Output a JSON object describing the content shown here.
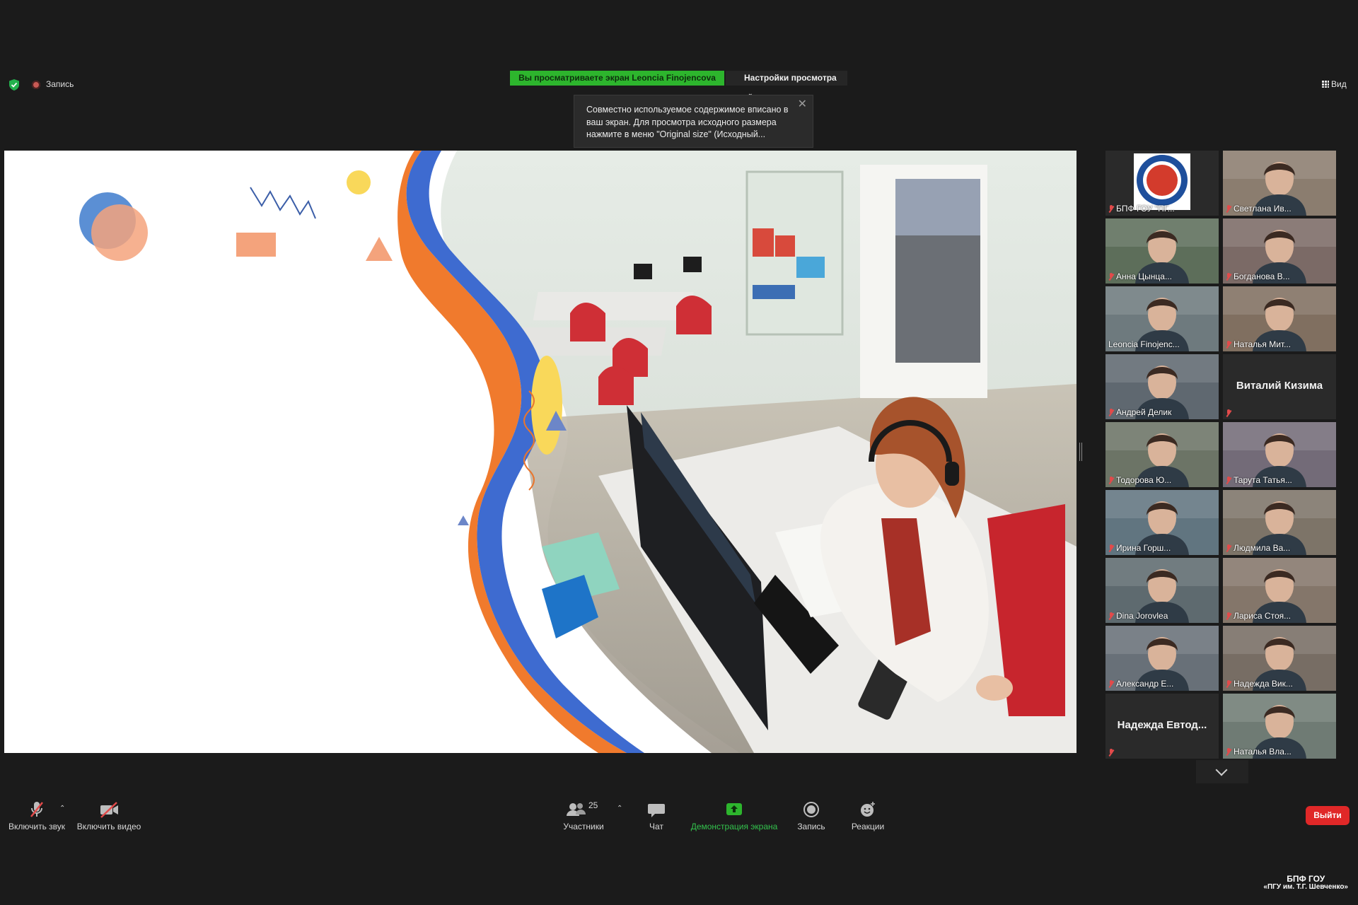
{
  "top_bar": {
    "recording_label": "Запись",
    "share_banner": "Вы просматриваете экран Leoncia Finojencova",
    "view_options": "Настройки просмотра",
    "view_button": "Вид"
  },
  "tooltip": {
    "text": "Совместно используемое содержимое вписано в ваш экран. Для просмотра исходного размера нажмите в меню \"Original size\" (Исходный..."
  },
  "gallery": [
    {
      "name": "БПФ ГОУ \"ПГ...",
      "muted": true,
      "kind": "logo"
    },
    {
      "name": "Светлана Ив...",
      "muted": true,
      "kind": "video"
    },
    {
      "name": "Анна Цынца...",
      "muted": true,
      "kind": "video"
    },
    {
      "name": "Богданова В...",
      "muted": true,
      "kind": "video"
    },
    {
      "name": "Leoncia Finojenc...",
      "muted": false,
      "kind": "video",
      "active": true
    },
    {
      "name": "Наталья Мит...",
      "muted": true,
      "kind": "video"
    },
    {
      "name": "Андрей Делик",
      "muted": true,
      "kind": "video"
    },
    {
      "name": "Виталий Кизима",
      "muted": true,
      "kind": "name"
    },
    {
      "name": "Тодорова Ю...",
      "muted": true,
      "kind": "video"
    },
    {
      "name": "Тарута Татья...",
      "muted": true,
      "kind": "video"
    },
    {
      "name": "Ирина Горш...",
      "muted": true,
      "kind": "video"
    },
    {
      "name": "Людмила Ва...",
      "muted": true,
      "kind": "video"
    },
    {
      "name": "Dina Jorovlea",
      "muted": true,
      "kind": "video"
    },
    {
      "name": "Лариса Стоя...",
      "muted": true,
      "kind": "video"
    },
    {
      "name": "Александр Е...",
      "muted": true,
      "kind": "video"
    },
    {
      "name": "Надежда Вик...",
      "muted": true,
      "kind": "video"
    },
    {
      "name": "Надежда  Евтод...",
      "muted": true,
      "kind": "name"
    },
    {
      "name": "Наталья Вла...",
      "muted": true,
      "kind": "video"
    }
  ],
  "toolbar": {
    "unmute_label": "Включить звук",
    "video_label": "Включить видео",
    "participants_label": "Участники",
    "participants_count": "25",
    "chat_label": "Чат",
    "share_label": "Демонстрация экрана",
    "record_label": "Запись",
    "reactions_label": "Реакции",
    "leave_label": "Выйти"
  },
  "watermark": {
    "line1": "БПФ ГОУ",
    "line2": "«ПГУ им. Т.Г. Шевченко»"
  },
  "colors": {
    "share_green": "#2db52d",
    "leave_red": "#e02828",
    "active_speaker": "#d8e24a",
    "muted_red": "#e24a4a"
  }
}
